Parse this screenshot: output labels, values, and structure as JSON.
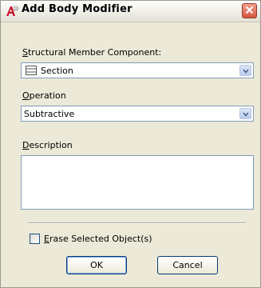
{
  "window": {
    "title": "Add Body Modifier",
    "icons": {
      "app": "autocad-app-icon",
      "close": "close-icon"
    }
  },
  "structural_member_component": {
    "label": "Structural Member Component:",
    "mnemonic": "S",
    "label_rest": "tructural Member Component:",
    "selected": "Section",
    "icon": "section-icon"
  },
  "operation": {
    "label": "Operation",
    "mnemonic": "O",
    "label_rest": "peration",
    "selected": "Subtractive"
  },
  "description": {
    "label": "Description",
    "mnemonic": "D",
    "label_rest": "escription",
    "value": ""
  },
  "erase_selected": {
    "label": "Erase Selected Object(s)",
    "mnemonic": "E",
    "label_rest": "rase Selected Object(s)",
    "checked": false
  },
  "buttons": {
    "ok": "OK",
    "cancel": "Cancel"
  },
  "colors": {
    "dialog_bg": "#ece9d8",
    "field_border": "#7f9db9",
    "close_button": "#d4553c"
  }
}
